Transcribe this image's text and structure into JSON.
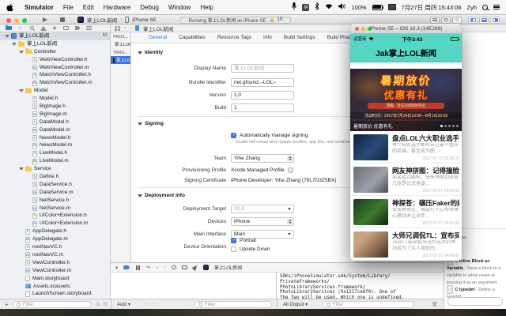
{
  "theme": {
    "teal": "#55d5c4",
    "xcode_blue": "#1d76de",
    "selection": "#d7dde5",
    "folder_yellow": "#f9c74f",
    "warning_yellow": "#f3b33d",
    "banner_yellow": "#ffd23e",
    "banner_orange": "#ff8a1c",
    "battery_green": "#52d766"
  },
  "menubar": {
    "menus": [
      "Simulator",
      "File",
      "Edit",
      "Hardware",
      "Debug",
      "Window",
      "Help"
    ],
    "status": {
      "input_glyph": "拼",
      "battery": "100%",
      "date": "7月27日 周四 15:43:06",
      "user": "Zyh"
    }
  },
  "xcode": {
    "toolbar": {
      "scheme_app": "掌上LOL新闻",
      "scheme_device": "iPhone SE",
      "activity": "Running 掌上LOL新闻 on iPhone SE",
      "warnings": "19"
    },
    "jumpbar": {
      "item": "掌上LOL新闻"
    },
    "navigator": {
      "filter_placeholder": "Filter",
      "items": [
        {
          "label": "掌上LOL新闻",
          "type": "project",
          "level": 0,
          "expanded": true,
          "selected": true,
          "badge": "M"
        },
        {
          "label": "掌上LOL新闻",
          "type": "group",
          "level": 1,
          "expanded": true
        },
        {
          "label": "Controller",
          "type": "group",
          "level": 2,
          "expanded": true
        },
        {
          "label": "WebViewController.h",
          "type": "h",
          "level": 3
        },
        {
          "label": "WebViewController.m",
          "type": "m",
          "level": 3
        },
        {
          "label": "MatchViewController.h",
          "type": "h",
          "level": 3
        },
        {
          "label": "MatchViewController.m",
          "type": "m",
          "level": 3
        },
        {
          "label": "Model",
          "type": "group",
          "level": 2,
          "expanded": true
        },
        {
          "label": "Model.h",
          "type": "h",
          "level": 3
        },
        {
          "label": "BigImage.h",
          "type": "h",
          "level": 3
        },
        {
          "label": "BigImage.m",
          "type": "m",
          "level": 3
        },
        {
          "label": "DataModel.h",
          "type": "h",
          "level": 3
        },
        {
          "label": "DataModel.m",
          "type": "m",
          "level": 3
        },
        {
          "label": "NewsModel.h",
          "type": "h",
          "level": 3
        },
        {
          "label": "NewsModel.m",
          "type": "m",
          "level": 3
        },
        {
          "label": "LiveModel.h",
          "type": "h",
          "level": 3
        },
        {
          "label": "LiveModel.m",
          "type": "m",
          "level": 3
        },
        {
          "label": "Service",
          "type": "group",
          "level": 2,
          "expanded": true
        },
        {
          "label": "Define.h",
          "type": "h",
          "level": 3
        },
        {
          "label": "DataService.h",
          "type": "h",
          "level": 3
        },
        {
          "label": "DataService.m",
          "type": "m",
          "level": 3
        },
        {
          "label": "NetService.h",
          "type": "h",
          "level": 3
        },
        {
          "label": "NetService.m",
          "type": "m",
          "level": 3
        },
        {
          "label": "UIColor+Extension.h",
          "type": "h",
          "level": 3
        },
        {
          "label": "UIColor+Extension.m",
          "type": "m",
          "level": 3
        },
        {
          "label": "AppDelegate.h",
          "type": "h",
          "level": 2
        },
        {
          "label": "AppDelegate.m",
          "type": "m",
          "level": 2
        },
        {
          "label": "rootNavVC.h",
          "type": "h",
          "level": 2
        },
        {
          "label": "rootNavVC.m",
          "type": "m",
          "level": 2
        },
        {
          "label": "ViewController.h",
          "type": "h",
          "level": 2
        },
        {
          "label": "ViewController.m",
          "type": "m",
          "level": 2
        },
        {
          "label": "Main.storyboard",
          "type": "storyboard",
          "level": 2
        },
        {
          "label": "Assets.xcassets",
          "type": "assets",
          "level": 2
        },
        {
          "label": "LaunchScreen.storyboard",
          "type": "storyboard",
          "level": 2
        }
      ]
    },
    "editor": {
      "project_header": "PROJ...",
      "targets_header": "TARG...",
      "project_name": "掌上LOL新闻",
      "target_name": "掌上LOL新闻",
      "tabs": [
        "General",
        "Capabilities",
        "Resource Tags",
        "Info",
        "Build Settings",
        "Build Phases"
      ],
      "selected_tab": "General",
      "sections": {
        "identity": {
          "title": "Identity",
          "display_name_label": "Display Name",
          "display_name_placeholder": "掌上LOL新闻",
          "bundle_label": "Bundle Identifier",
          "bundle_value": "net.gfound.--LOL--",
          "version_label": "Version",
          "version_value": "1.0",
          "build_label": "Build",
          "build_value": "1"
        },
        "signing": {
          "title": "Signing",
          "auto_label": "Automatically manage signing",
          "auto_checked": true,
          "note": "Xcode will create and update profiles, app IDs, and certificates.",
          "team_label": "Team",
          "team_value": "Yihe Zhang",
          "profile_label": "Provisioning Profile",
          "profile_value": "Xcode Managed Profile",
          "cert_label": "Signing Certificate",
          "cert_value": "iPhone Developer: Yihe Zhang (78L7D3Z5BX)"
        },
        "deployment": {
          "title": "Deployment Info",
          "target_label": "Deployment Target",
          "target_value": "10.3",
          "devices_label": "Devices",
          "devices_value": "iPhone",
          "main_label": "Main Interface",
          "main_value": "Main",
          "orientation_label": "Device Orientation",
          "orientations": [
            {
              "label": "Portrait",
              "checked": true
            },
            {
              "label": "Upside Down",
              "checked": false
            }
          ]
        }
      }
    },
    "debug": {
      "process": "掌上LOL新闻",
      "variables_scope": "Auto",
      "console_scope": "All Output",
      "filter_placeholder": "Filter",
      "console_lines": [
        "SDKs/iPhoneSimulator.sdk/System/Library/",
        "PrivateFrameworks/",
        "PhotoLibraryServices.framework/",
        "PhotoLibraryServices (0x1217ce6f0). One of",
        "the two will be used. Which one is undefined."
      ]
    },
    "utilities": {
      "partial_text": "a block as.",
      "snippets": [
        {
          "title": "C Inline Block as Variable",
          "desc": " - Save a block to a variable to allow reuse or passing it as an argument."
        },
        {
          "title": "C typedef",
          "desc": " - Define a typedef."
        }
      ]
    }
  },
  "simulator": {
    "window_title": "iPhone SE – iOS 10.3 (14E269)",
    "statusbar": {
      "carrier": "运营商",
      "time": "下午3:43"
    },
    "nav_title": "Jak掌上LOL新闻",
    "banner": {
      "headline1": "暑期放价",
      "headline2": "优惠有礼",
      "ribbon": "西服、宝石活动限时开启",
      "schedule": "活动时间：2017年7月24日10:00—8月1日23:59",
      "caption": "暑期放价 优惠有礼",
      "page_count": 5,
      "active_page": 0
    },
    "news": [
      {
        "title": "盘点LOL六大职业选手…",
        "subtitle": "每个知名选手都有自己最不擅长的英雄，甚至成为职…",
        "time": "2017-07-27 15:25:26"
      },
      {
        "title": "网友神拼图：记得撞脸…",
        "subtitle": "笑笑接连躺枪，快来拼图到底哪几张是记浑身姿…",
        "time": "2017-07-27 14:54:23"
      },
      {
        "title": "神探苍：碾压Faker的妖…",
        "subtitle": "双兔傍地走，假装打不过等等傅心理战术让对手…",
        "time": "2017-07-27 15:01:33"
      },
      {
        "title": "大师兄调侃TL：宣布买…",
        "subtitle": "Team Liquid疯狂签约选手的举动成为了众人调侃的…",
        "time": "2017-07-27 14:43:49"
      }
    ]
  }
}
